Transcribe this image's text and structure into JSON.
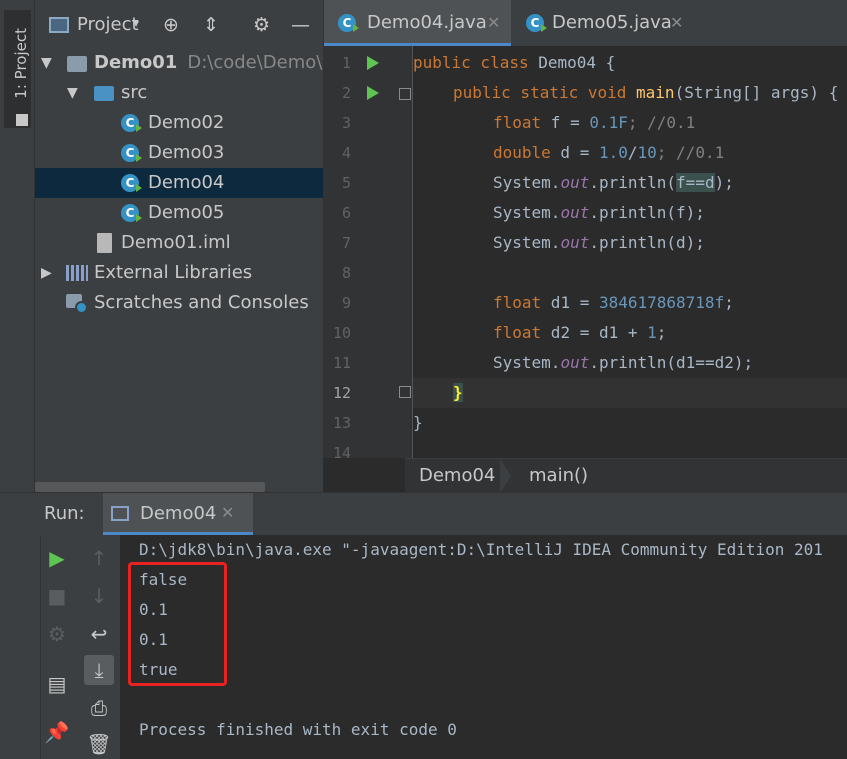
{
  "toolwindow": {
    "project_tab_label": "1: Project"
  },
  "project_panel": {
    "title": "Project",
    "tree": [
      {
        "label": "Demo01",
        "path": "D:\\code\\Demo\\D",
        "kind": "module",
        "expanded": true
      },
      {
        "label": "src",
        "kind": "folder",
        "expanded": true
      },
      {
        "label": "Demo02",
        "kind": "class"
      },
      {
        "label": "Demo03",
        "kind": "class"
      },
      {
        "label": "Demo04",
        "kind": "class",
        "selected": true
      },
      {
        "label": "Demo05",
        "kind": "class"
      },
      {
        "label": "Demo01.iml",
        "kind": "file"
      },
      {
        "label": "External Libraries",
        "kind": "libraries",
        "expanded": false
      },
      {
        "label": "Scratches and Consoles",
        "kind": "scratches"
      }
    ]
  },
  "editor": {
    "tabs": [
      {
        "label": "Demo04.java",
        "active": true
      },
      {
        "label": "Demo05.java",
        "active": false
      }
    ],
    "line_numbers": [
      "1",
      "2",
      "3",
      "4",
      "5",
      "6",
      "7",
      "8",
      "9",
      "10",
      "11",
      "12",
      "13",
      "14"
    ],
    "current_line": "12",
    "code": {
      "l1": {
        "kw": "public class",
        "rest": " Demo04 {"
      },
      "l2": {
        "kw": "public static void",
        "name": "main",
        "rest": "(String[] args) {"
      },
      "l3": {
        "kw": "float",
        "rest": " f = ",
        "num": "0.1F",
        "cmt": "; //0.1"
      },
      "l4": {
        "kw": "double",
        "rest": " d = ",
        "num1": "1.0",
        "op": "/",
        "num2": "10",
        "cmt": "; //0.1"
      },
      "l5": {
        "pre": "System.",
        "fld": "out",
        "mid": ".println(",
        "hl": "f==d",
        "post": ");"
      },
      "l6": {
        "pre": "System.",
        "fld": "out",
        "post": ".println(f);"
      },
      "l7": {
        "pre": "System.",
        "fld": "out",
        "post": ".println(d);"
      },
      "l9": {
        "kw": "float",
        "rest": " d1 = ",
        "num": "384617868718f",
        "post": ";"
      },
      "l10": {
        "kw": "float",
        "rest": " d2 = d1 + ",
        "num": "1",
        "post": ";"
      },
      "l11": {
        "pre": "System.",
        "fld": "out",
        "post": ".println(d1==d2);"
      },
      "l12": {
        "brace": "}"
      },
      "l13": {
        "brace": "}"
      }
    },
    "breadcrumbs": [
      "Demo04",
      "main()"
    ]
  },
  "run_panel": {
    "label": "Run:",
    "tab_label": "Demo04",
    "command": "D:\\jdk8\\bin\\java.exe \"-javaagent:D:\\IntelliJ IDEA Community Edition 201",
    "output": [
      "false",
      "0.1",
      "0.1",
      "true"
    ],
    "exit_message": "Process finished with exit code 0"
  },
  "colors": {
    "highlight_box": "#e8231f",
    "accent": "#4a88c7",
    "run_green": "#5ec452"
  },
  "icons": [
    "project-folder-icon",
    "target-icon",
    "collapse-icon",
    "gear-icon",
    "minimize-icon",
    "class-icon",
    "run-icon",
    "stop-icon",
    "rerun-icon",
    "up-arrow-icon",
    "down-arrow-icon",
    "soft-wrap-icon",
    "scroll-to-end-icon",
    "print-icon",
    "trash-icon",
    "pin-icon",
    "layout-icon"
  ]
}
